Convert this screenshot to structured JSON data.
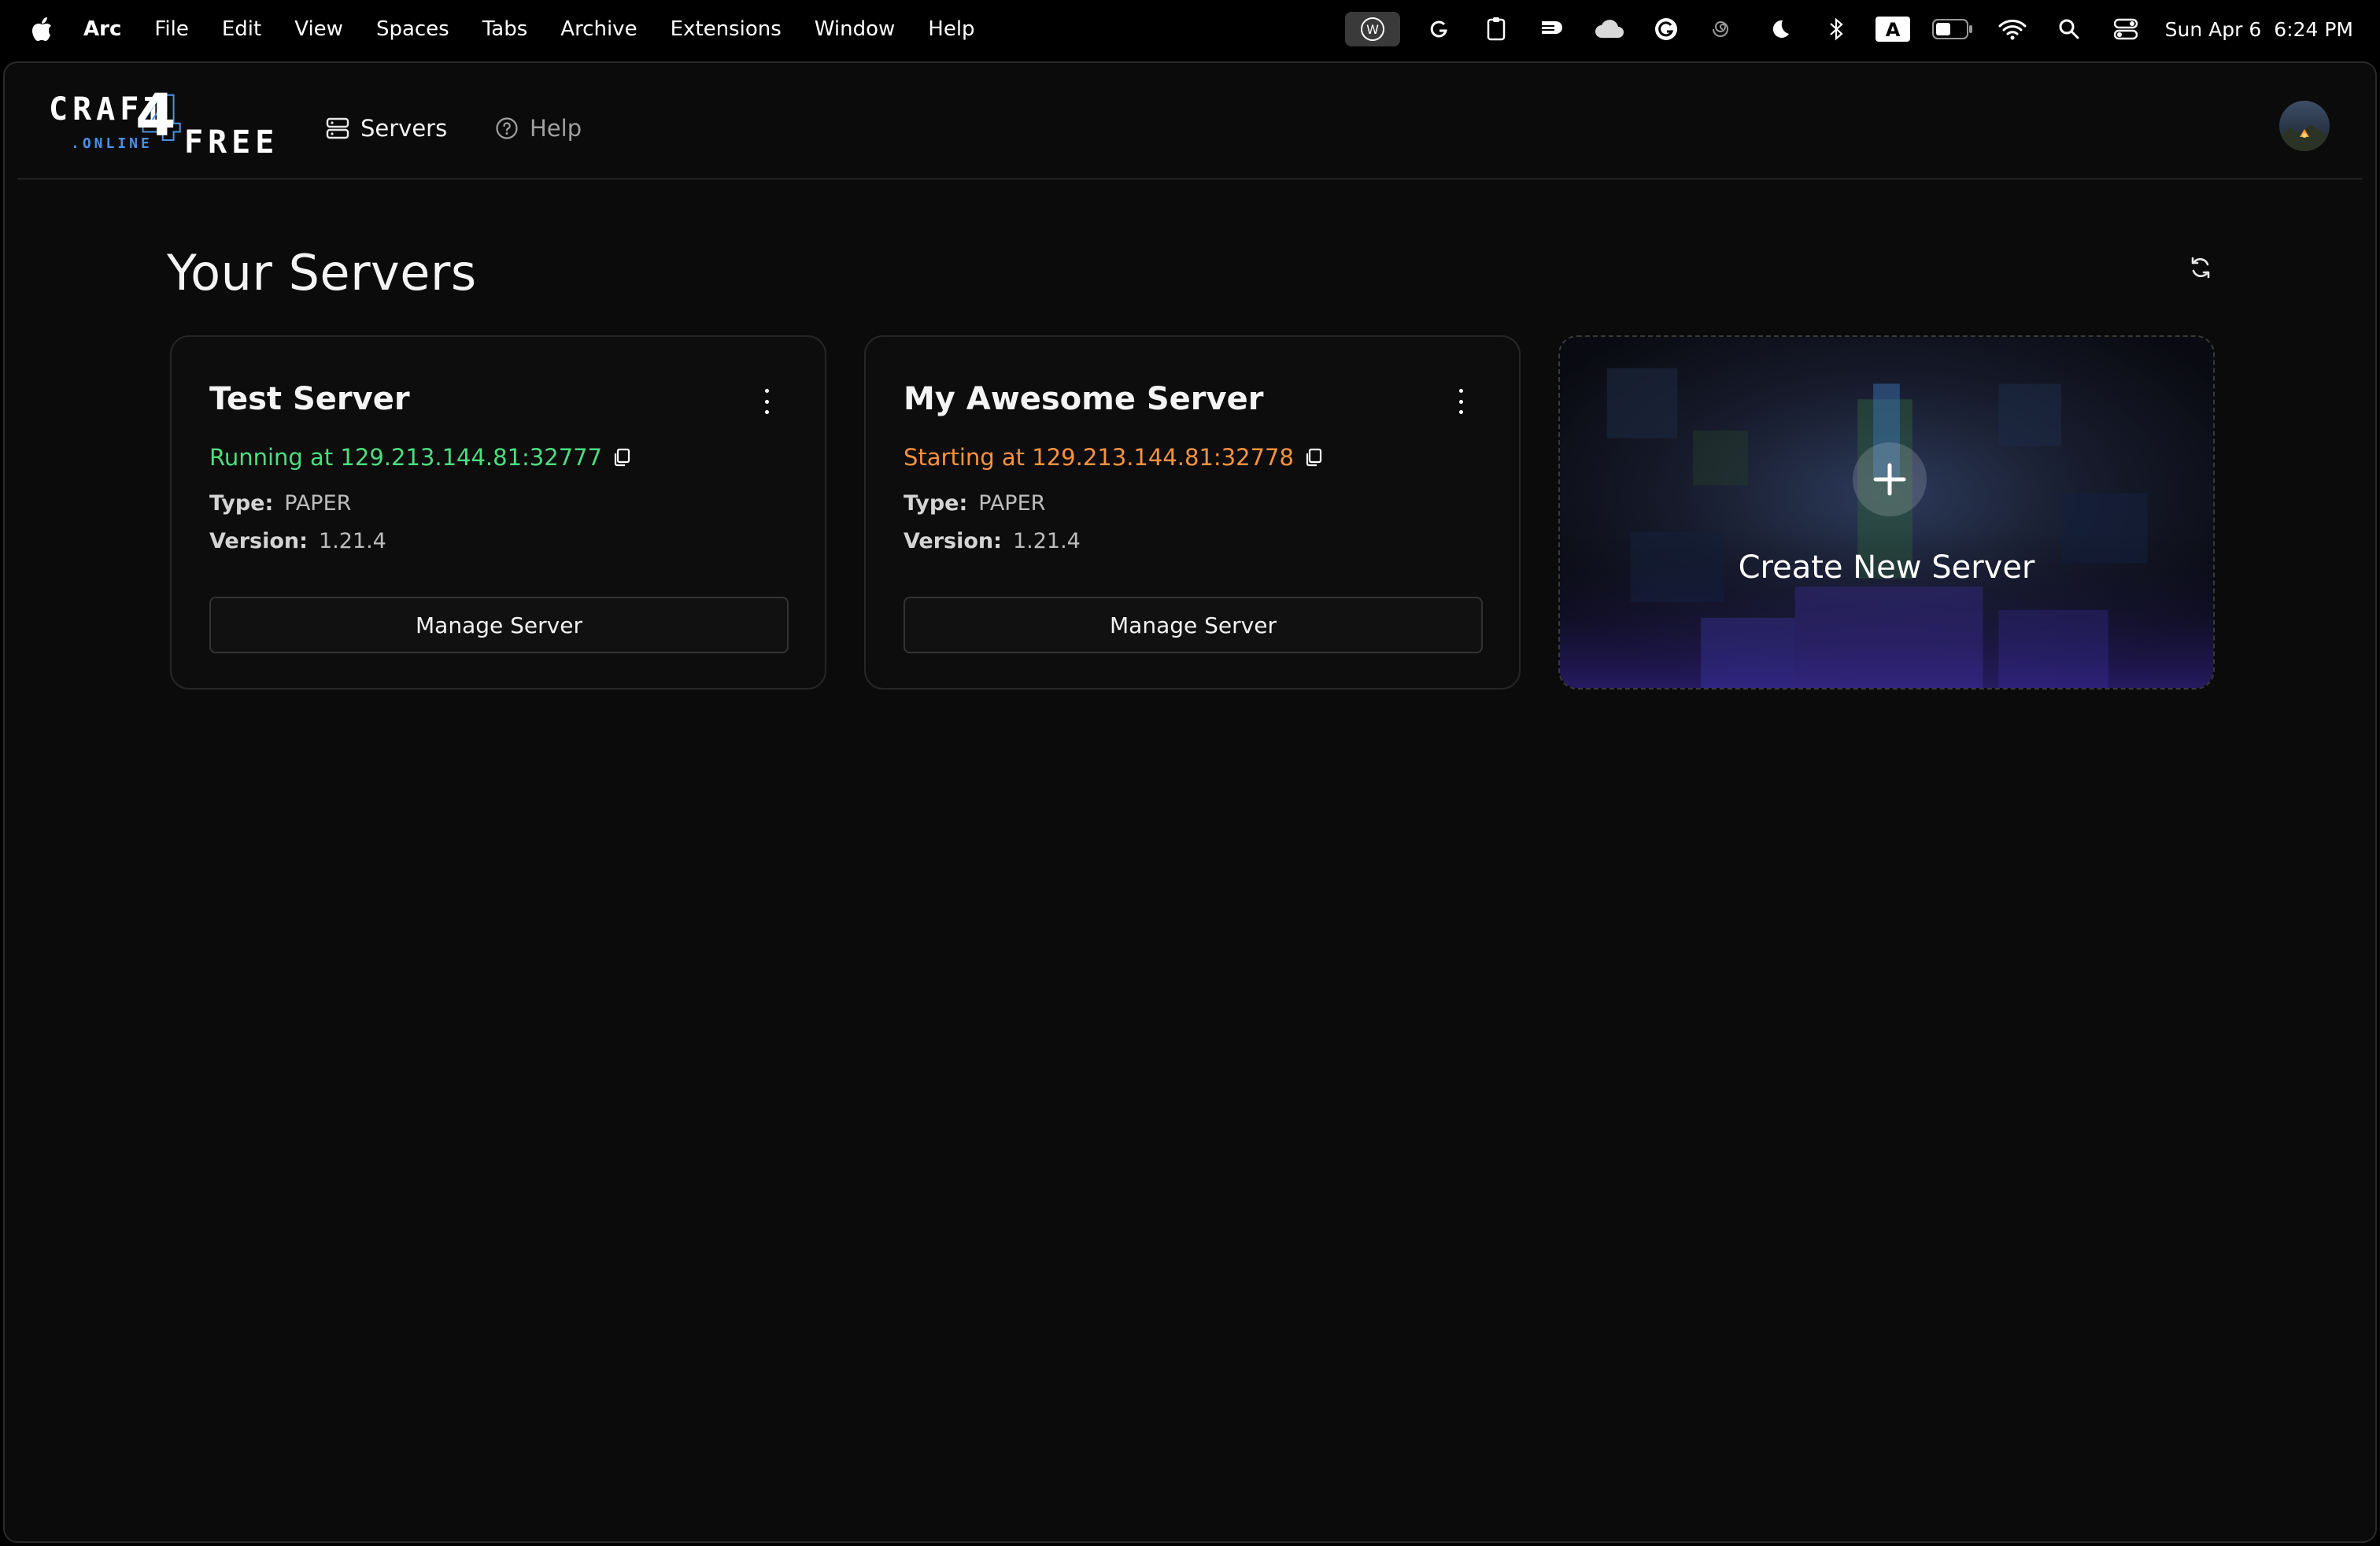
{
  "menubar": {
    "app_name": "Arc",
    "items": [
      "File",
      "Edit",
      "View",
      "Spaces",
      "Tabs",
      "Archive",
      "Extensions",
      "Window",
      "Help"
    ],
    "tray_icons": [
      "wordpress-icon",
      "g-arrow-icon",
      "clipboard-icon",
      "notes-icon",
      "cloud-icon",
      "grammarly-icon",
      "spiral-icon",
      "moon-icon",
      "bluetooth-icon",
      "keyboard-a-icon",
      "battery-icon",
      "wifi-icon",
      "search-icon",
      "control-center-icon"
    ],
    "keyboard_badge": "A",
    "clock": {
      "date": "Sun Apr 6",
      "time": "6:24 PM"
    }
  },
  "nav": {
    "logo": {
      "top": "CRAFT",
      "bottom": ".ONLINE",
      "right": "FREE",
      "accent": "4"
    },
    "servers_label": "Servers",
    "help_label": "Help"
  },
  "page": {
    "title": "Your Servers"
  },
  "servers": [
    {
      "name": "Test Server",
      "status_prefix": "Running at",
      "address": "129.213.144.81:32777",
      "status_color": "#4ade80",
      "type_label": "Type:",
      "type": "PAPER",
      "version_label": "Version:",
      "version": "1.21.4",
      "button": "Manage Server"
    },
    {
      "name": "My Awesome Server",
      "status_prefix": "Starting at",
      "address": "129.213.144.81:32778",
      "status_color": "#fb923c",
      "type_label": "Type:",
      "type": "PAPER",
      "version_label": "Version:",
      "version": "1.21.4",
      "button": "Manage Server"
    }
  ],
  "create": {
    "label": "Create New Server"
  },
  "colors": {
    "background": "#0b0b0b",
    "card_border": "#262626",
    "running": "#4ade80",
    "starting": "#fb923c"
  }
}
